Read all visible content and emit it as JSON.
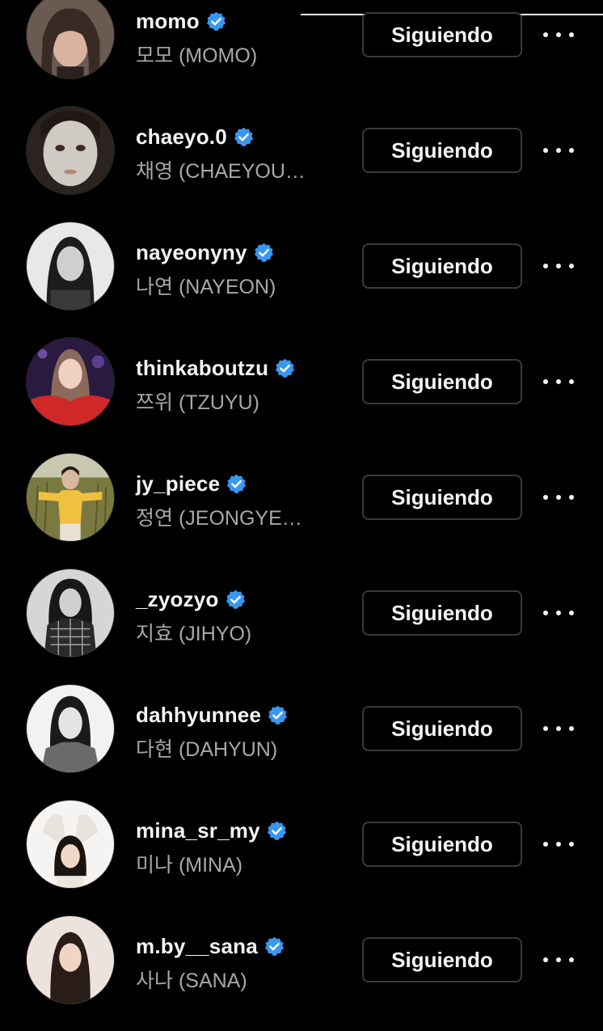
{
  "following_list": {
    "button_label": "Siguiendo",
    "accent_color": "#3897f0",
    "items": [
      {
        "username": "momo",
        "full_name": "모모 (MOMO)",
        "verified": true
      },
      {
        "username": "chaeyo.0",
        "full_name": "채영 (CHAEYOU…",
        "verified": true
      },
      {
        "username": "nayeonyny",
        "full_name": "나연 (NAYEON)",
        "verified": true
      },
      {
        "username": "thinkaboutzu",
        "full_name": "쯔위 (TZUYU)",
        "verified": true
      },
      {
        "username": "jy_piece",
        "full_name": "정연 (JEONGYE…",
        "verified": true
      },
      {
        "username": "_zyozyo",
        "full_name": "지효 (JIHYO)",
        "verified": true
      },
      {
        "username": "dahhyunnee",
        "full_name": "다현 (DAHYUN)",
        "verified": true
      },
      {
        "username": "mina_sr_my",
        "full_name": "미나 (MINA)",
        "verified": true
      },
      {
        "username": "m.by__sana",
        "full_name": "사나 (SANA)",
        "verified": true
      }
    ]
  }
}
